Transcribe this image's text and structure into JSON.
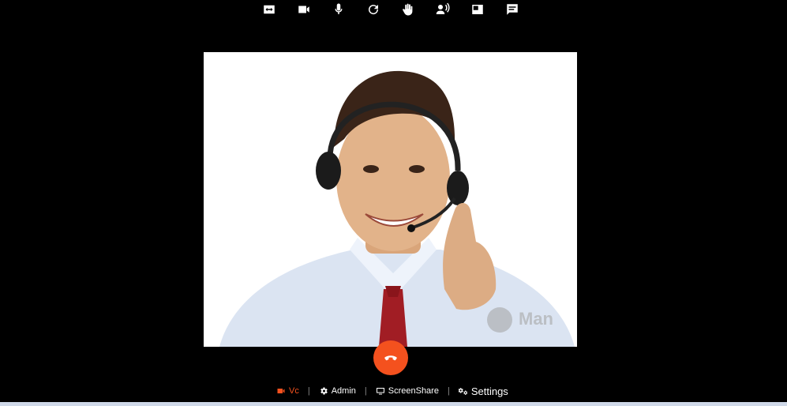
{
  "toolbar": {
    "buttons": [
      {
        "name": "swap-icon"
      },
      {
        "name": "video-camera-icon"
      },
      {
        "name": "microphone-icon"
      },
      {
        "name": "refresh-icon"
      },
      {
        "name": "raise-hand-icon"
      },
      {
        "name": "speaker-voice-icon"
      },
      {
        "name": "layout-icon"
      },
      {
        "name": "chat-icon"
      }
    ]
  },
  "video": {
    "watermark": "Man"
  },
  "end_call": {
    "icon": "end-call-icon",
    "color": "#f4511e"
  },
  "bottom_nav": {
    "items": [
      {
        "label": "Vc",
        "icon": "video-camera-icon",
        "active": true
      },
      {
        "label": "Admin",
        "icon": "gear-icon"
      },
      {
        "label": "ScreenShare",
        "icon": "monitor-icon"
      },
      {
        "label": "Settings",
        "icon": "gears-icon"
      }
    ]
  },
  "colors": {
    "accent": "#f4511e",
    "background": "#000000"
  }
}
